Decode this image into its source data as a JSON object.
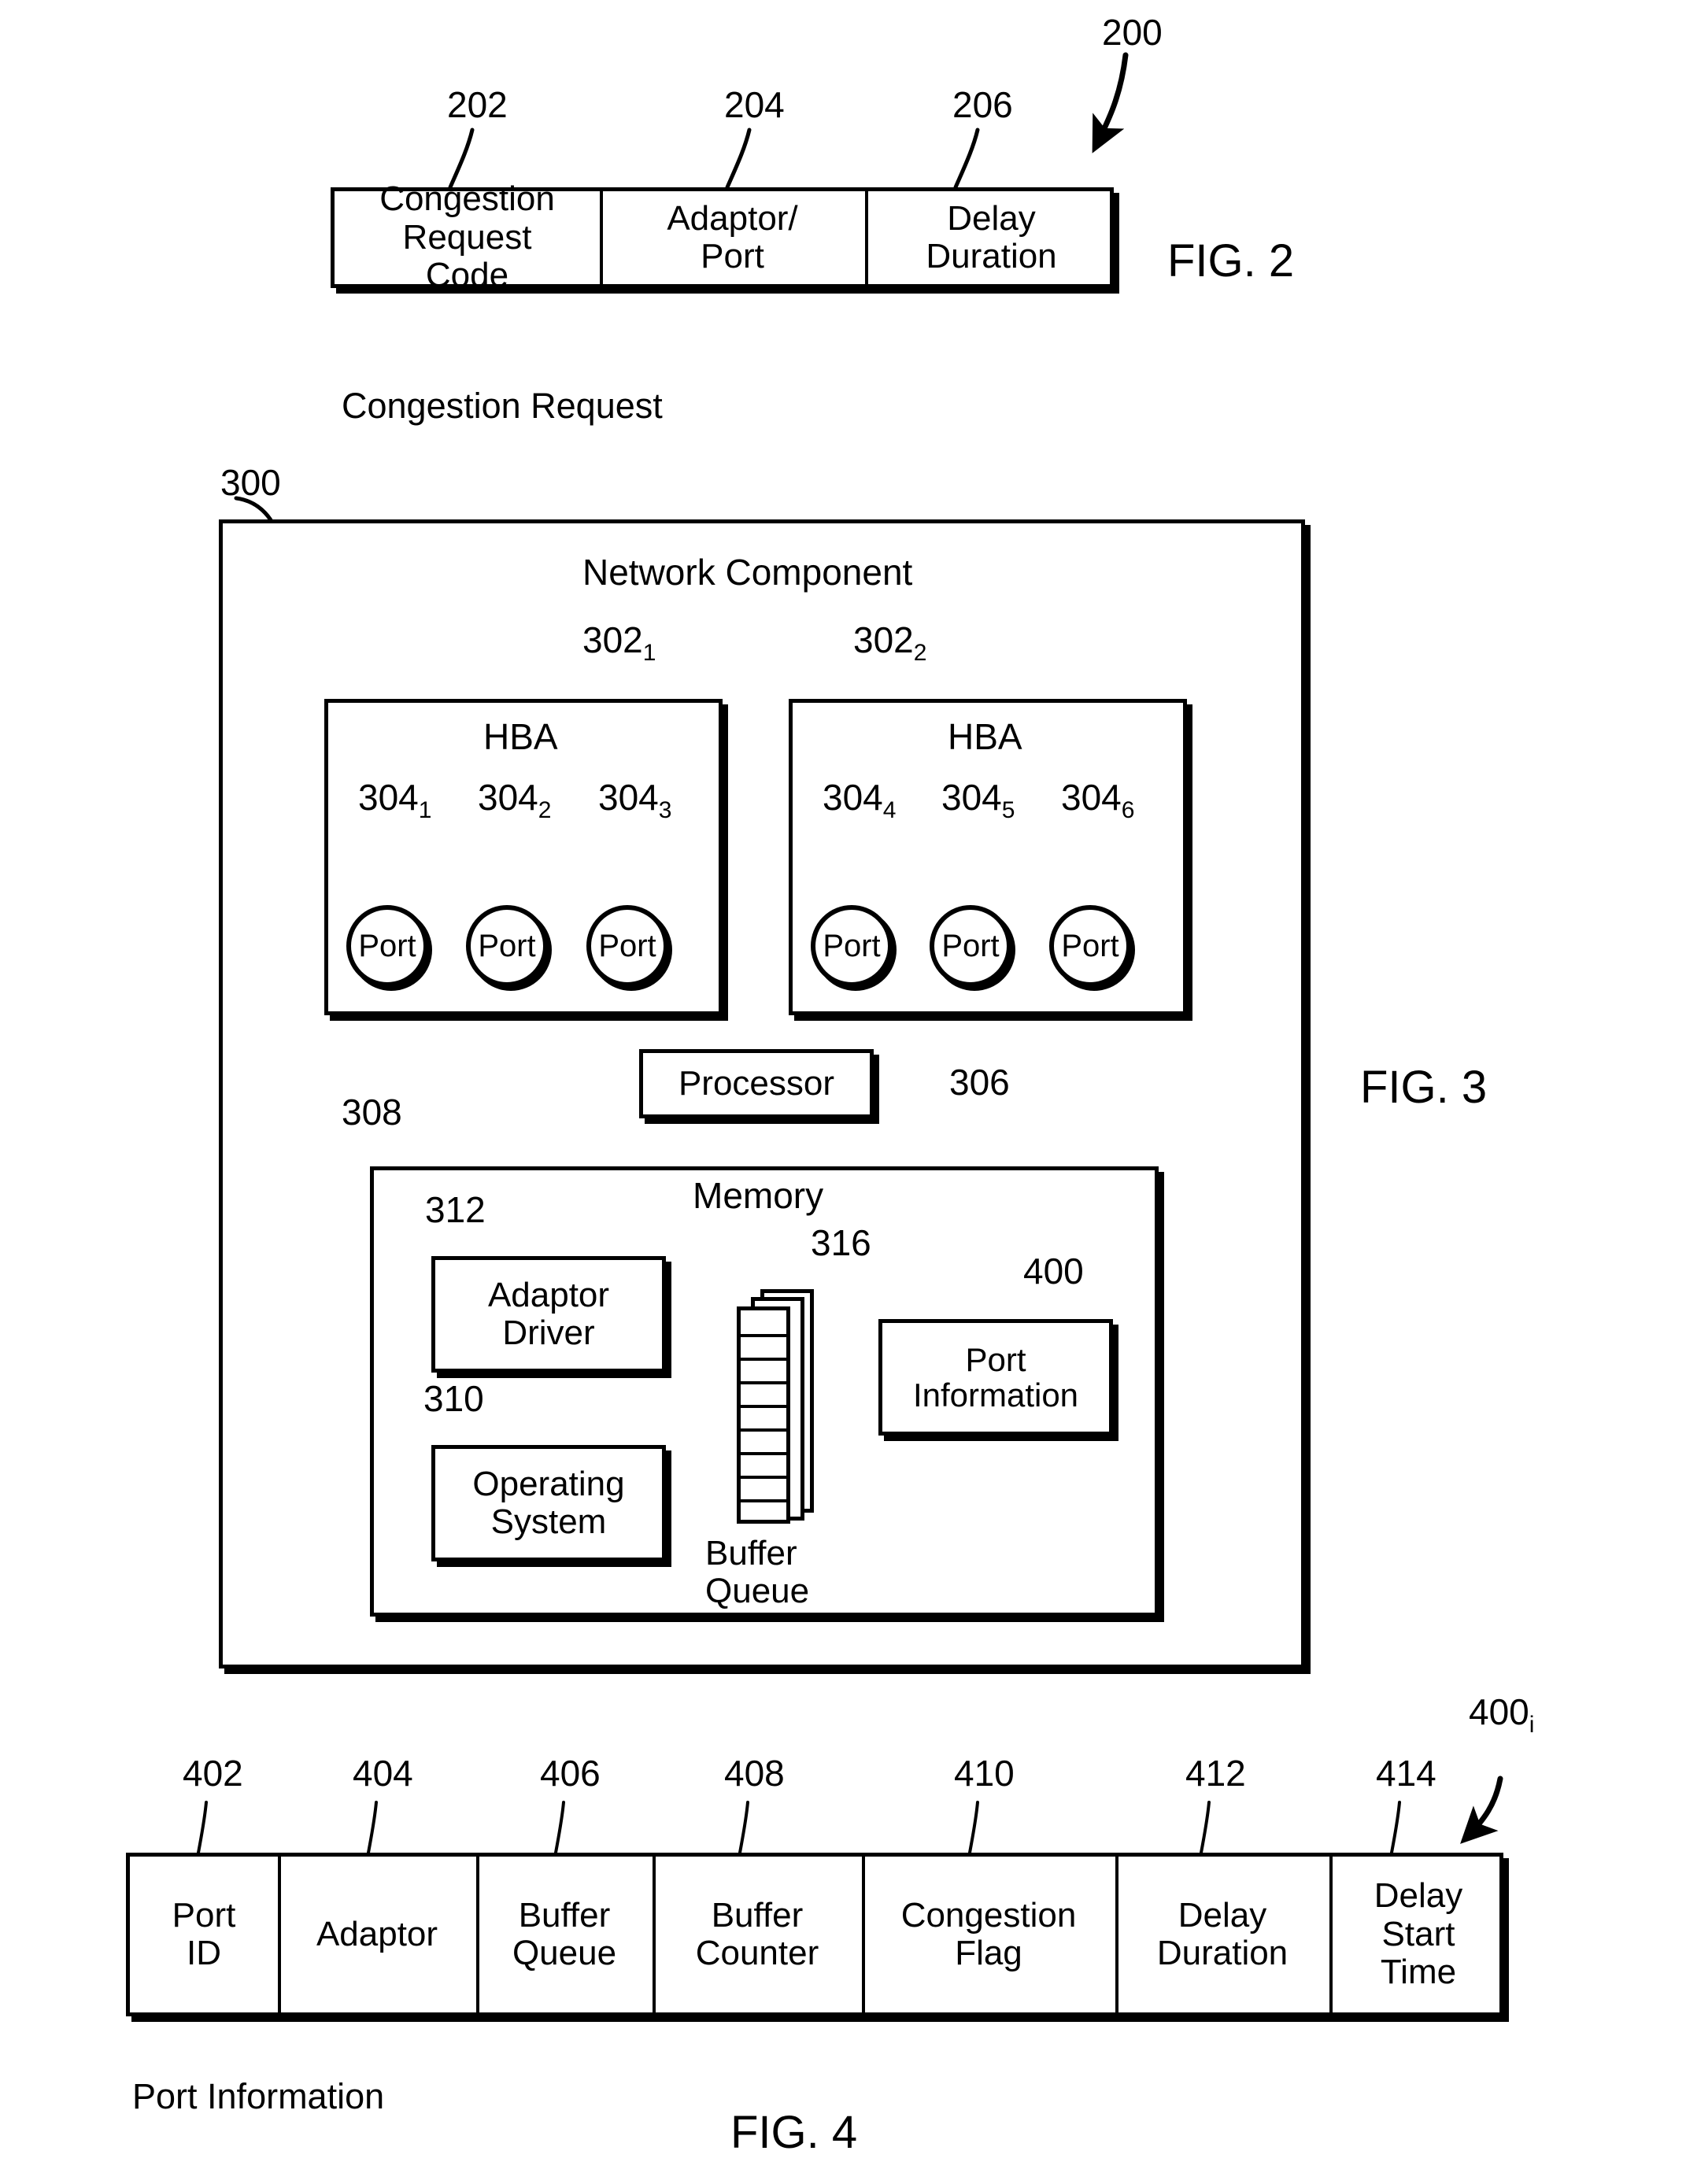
{
  "figures": [
    {
      "id": "fig2",
      "label": "FIG. 2",
      "ref": "200",
      "caption": "Congestion Request",
      "fields": [
        {
          "ref": "202",
          "label": "Congestion\nRequest\nCode"
        },
        {
          "ref": "204",
          "label": "Adaptor/\nPort"
        },
        {
          "ref": "206",
          "label": "Delay\nDuration"
        }
      ]
    },
    {
      "id": "fig3",
      "label": "FIG. 3",
      "ref": "300",
      "title": "Network Component",
      "hbas": [
        {
          "ref": "302",
          "sub": "1",
          "label": "HBA",
          "ports": [
            {
              "ref": "304",
              "sub": "1",
              "label": "Port"
            },
            {
              "ref": "304",
              "sub": "2",
              "label": "Port"
            },
            {
              "ref": "304",
              "sub": "3",
              "label": "Port"
            }
          ]
        },
        {
          "ref": "302",
          "sub": "2",
          "label": "HBA",
          "ports": [
            {
              "ref": "304",
              "sub": "4",
              "label": "Port"
            },
            {
              "ref": "304",
              "sub": "5",
              "label": "Port"
            },
            {
              "ref": "304",
              "sub": "6",
              "label": "Port"
            }
          ]
        }
      ],
      "processor": {
        "ref": "306",
        "label": "Processor"
      },
      "memory": {
        "ref": "308",
        "title": "Memory",
        "items": [
          {
            "ref": "312",
            "label": "Adaptor\nDriver"
          },
          {
            "ref": "310",
            "label": "Operating\nSystem"
          },
          {
            "ref": "316",
            "label": "Buffer\nQueue"
          },
          {
            "ref": "400",
            "label": "Port\nInformation"
          }
        ]
      }
    },
    {
      "id": "fig4",
      "label": "FIG. 4",
      "ref": "400",
      "ref_sub": "i",
      "caption": "Port Information",
      "fields": [
        {
          "ref": "402",
          "label": "Port\nID"
        },
        {
          "ref": "404",
          "label": "Adaptor"
        },
        {
          "ref": "406",
          "label": "Buffer\nQueue"
        },
        {
          "ref": "408",
          "label": "Buffer\nCounter"
        },
        {
          "ref": "410",
          "label": "Congestion\nFlag"
        },
        {
          "ref": "412",
          "label": "Delay\nDuration"
        },
        {
          "ref": "414",
          "label": "Delay\nStart\nTime"
        }
      ]
    }
  ],
  "colors": {
    "ink": "#000000",
    "paper": "#ffffff"
  }
}
